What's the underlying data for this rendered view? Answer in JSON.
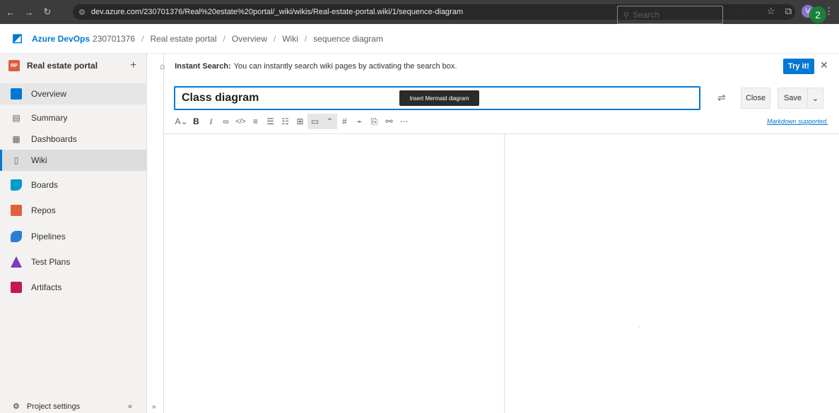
{
  "browser": {
    "url": "dev.azure.com/230701376/Real%20estate%20portal/_wiki/wikis/Real-estate-portal.wiki/1/sequence-diagram",
    "profile_initial": "V"
  },
  "header": {
    "brand": "Azure DevOps",
    "org": "230701376",
    "breadcrumbs": [
      "Real estate portal",
      "Overview",
      "Wiki",
      "sequence diagram"
    ],
    "search_placeholder": "Search",
    "user_badge": "2"
  },
  "sidebar": {
    "project_initials": "RP",
    "project_name": "Real estate portal",
    "items": [
      {
        "label": "Overview",
        "icon": "overview-icon"
      },
      {
        "label": "Summary",
        "icon": "summary-icon"
      },
      {
        "label": "Dashboards",
        "icon": "dashboards-icon"
      },
      {
        "label": "Wiki",
        "icon": "wiki-icon"
      },
      {
        "label": "Boards",
        "icon": "boards-icon"
      },
      {
        "label": "Repos",
        "icon": "repos-icon"
      },
      {
        "label": "Pipelines",
        "icon": "pipelines-icon"
      },
      {
        "label": "Test Plans",
        "icon": "test-plans-icon"
      },
      {
        "label": "Artifacts",
        "icon": "artifacts-icon"
      }
    ],
    "settings_label": "Project settings"
  },
  "banner": {
    "title": "Instant Search:",
    "text": "You can instantly search wiki pages by activating the search box.",
    "button": "Try it!"
  },
  "editor": {
    "page_title": "Class diagram",
    "tooltip": "Insert Mermaid diagram",
    "close_label": "Close",
    "save_label": "Save",
    "markdown_link": "Markdown supported."
  }
}
